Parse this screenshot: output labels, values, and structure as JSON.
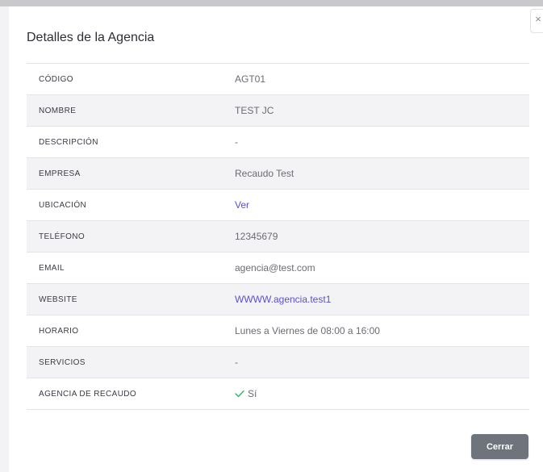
{
  "modal": {
    "title": "Detalles de la Agencia",
    "close_glyph": "×",
    "close_button_label": "Cerrar"
  },
  "details": [
    {
      "label": "CÓDIGO",
      "value": "AGT01",
      "link": false
    },
    {
      "label": "NOMBRE",
      "value": "TEST JC",
      "link": false
    },
    {
      "label": "DESCRIPCIÓN",
      "value": "-",
      "link": false
    },
    {
      "label": "EMPRESA",
      "value": "Recaudo Test",
      "link": false
    },
    {
      "label": "UBICACIÓN",
      "value": "Ver",
      "link": true
    },
    {
      "label": "TELÉFONO",
      "value": "12345679",
      "link": false
    },
    {
      "label": "EMAIL",
      "value": "agencia@test.com",
      "link": false
    },
    {
      "label": "WEBSITE",
      "value": "WWWW.agencia.test1",
      "link": true
    },
    {
      "label": "HORARIO",
      "value": "Lunes a Viernes de 08:00 a 16:00",
      "link": false
    },
    {
      "label": "SERVICIOS",
      "value": "-",
      "link": false
    },
    {
      "label": "AGENCIA DE RECAUDO",
      "value": "Sí",
      "link": false,
      "icon": "check-icon"
    }
  ],
  "colors": {
    "link": "#5b4fd6",
    "check": "#34b36b",
    "button": "#6e737c",
    "row_alt": "#f3f3f5"
  }
}
